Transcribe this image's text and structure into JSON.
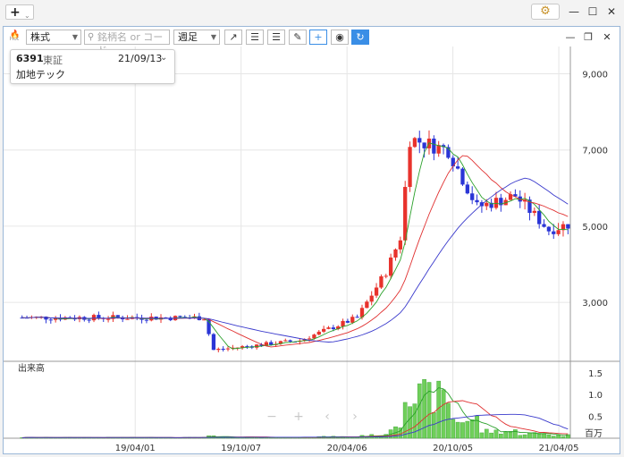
{
  "titlebar": {
    "add_label": "+",
    "add_caret": "⌄",
    "gear": "⚙",
    "minimize": "—",
    "maximize": "☐",
    "close": "✕"
  },
  "toolbar": {
    "hot_label": "Hot",
    "market_select": "株式",
    "search_placeholder": "銘柄名 or コード",
    "period_select": "週足",
    "buttons": {
      "trend": "↗",
      "hline": "☰",
      "hline2": "☰",
      "pencil": "✎",
      "crosshair": "+",
      "camera": "◉",
      "refresh": "↻"
    },
    "panel_minimize": "—",
    "panel_restore": "❐",
    "panel_close": "✕"
  },
  "info": {
    "code": "6391",
    "market": "東証",
    "date": "21/09/13",
    "name": "加地テック",
    "chevron": "⌄"
  },
  "chart_data": {
    "type": "candlestick",
    "period": "weekly",
    "price_axis": {
      "ticks": [
        3000,
        5000,
        7000,
        9000
      ],
      "tick_labels": [
        "3,000",
        "5,000",
        "7,000",
        "9,000"
      ],
      "ylim": [
        1500,
        9600
      ]
    },
    "x_axis": {
      "tick_labels": [
        "19/04/01",
        "19/10/07",
        "20/04/06",
        "20/10/05",
        "21/04/05"
      ]
    },
    "volume_axis": {
      "title": "出来高",
      "ticks": [
        0.5,
        1.0,
        1.5
      ],
      "tick_labels": [
        "0.5",
        "1.0",
        "1.5"
      ],
      "unit": "百万",
      "ylim": [
        0,
        1.7
      ]
    },
    "colors": {
      "up": "#e8322c",
      "down": "#2a35d6",
      "ma_short": "#2aa02a",
      "ma_mid": "#e03030",
      "ma_long": "#3a3acc",
      "volume": "#6fcf5a"
    },
    "segments": [
      {
        "n": 36,
        "from": 2600,
        "to": 2600,
        "vol": 0.015
      },
      {
        "n": 3,
        "from": 2600,
        "to": 2600,
        "vol": 0.02
      },
      {
        "n": 2,
        "from": 2600,
        "to": 1750,
        "vol": 0.04
      },
      {
        "n": 18,
        "from": 1750,
        "to": 2000,
        "vol": 0.02
      },
      {
        "n": 12,
        "from": 2000,
        "to": 2600,
        "vol": 0.03
      },
      {
        "n": 6,
        "from": 2600,
        "to": 3800,
        "vol": 0.06
      },
      {
        "n": 3,
        "from": 3800,
        "to": 4700,
        "vol": 0.3
      },
      {
        "n": 2,
        "from": 4700,
        "to": 7300,
        "vol": 1.2
      },
      {
        "n": 8,
        "from": 7300,
        "to": 7000,
        "vol": 0.9
      },
      {
        "n": 6,
        "from": 7000,
        "to": 5500,
        "vol": 0.4
      },
      {
        "n": 8,
        "from": 5500,
        "to": 5800,
        "vol": 0.15
      },
      {
        "n": 7,
        "from": 5800,
        "to": 4900,
        "vol": 0.1
      },
      {
        "n": 4,
        "from": 4900,
        "to": 5050,
        "vol": 0.06
      }
    ],
    "navigation": {
      "zoom_out": "−",
      "zoom_in": "+",
      "prev": "‹",
      "next": "›"
    }
  }
}
